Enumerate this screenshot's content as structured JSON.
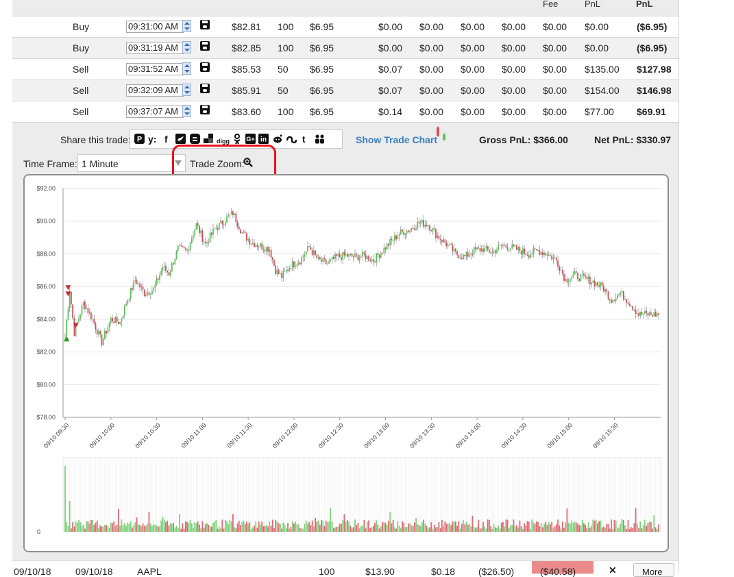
{
  "table_header": {
    "col_fee": "Fee",
    "col_pnl": "PnL",
    "col_net_pnl": "PnL"
  },
  "trades": [
    {
      "side": "Buy",
      "time": "09:31:00 AM",
      "price": "$82.81",
      "qty": "100",
      "commission": "$6.95",
      "f1": "$0.00",
      "f2": "$0.00",
      "f3": "$0.00",
      "f4": "$0.00",
      "f5": "$0.00",
      "pnl": "$0.00",
      "net": "($6.95)"
    },
    {
      "side": "Buy",
      "time": "09:31:19 AM",
      "price": "$82.85",
      "qty": "100",
      "commission": "$6.95",
      "f1": "$0.00",
      "f2": "$0.00",
      "f3": "$0.00",
      "f4": "$0.00",
      "f5": "$0.00",
      "pnl": "$0.00",
      "net": "($6.95)"
    },
    {
      "side": "Sell",
      "time": "09:31:52 AM",
      "price": "$85.53",
      "qty": "50",
      "commission": "$6.95",
      "f1": "$0.07",
      "f2": "$0.00",
      "f3": "$0.00",
      "f4": "$0.00",
      "f5": "$0.00",
      "pnl": "$135.00",
      "net": "$127.98"
    },
    {
      "side": "Sell",
      "time": "09:32:09 AM",
      "price": "$85.91",
      "qty": "50",
      "commission": "$6.95",
      "f1": "$0.07",
      "f2": "$0.00",
      "f3": "$0.00",
      "f4": "$0.00",
      "f5": "$0.00",
      "pnl": "$154.00",
      "net": "$146.98"
    },
    {
      "side": "Sell",
      "time": "09:37:07 AM",
      "price": "$83.60",
      "qty": "100",
      "commission": "$6.95",
      "f1": "$0.14",
      "f2": "$0.00",
      "f3": "$0.00",
      "f4": "$0.00",
      "f5": "$0.00",
      "pnl": "$77.00",
      "net": "$69.91"
    }
  ],
  "share": {
    "label": "Share this trade:",
    "icons": [
      "pinterest-icon",
      "yummly-icon",
      "facebook-icon",
      "twitter-icon",
      "blogger-icon",
      "delicious-icon",
      "digg-icon",
      "odnoklassniki-icon",
      "google-plus-icon",
      "linkedin-icon",
      "reddit-icon",
      "stumbleupon-icon",
      "tumblr-icon",
      "myspace-icon"
    ],
    "digg_text": "digg"
  },
  "show_trade_chart": "Show Trade Chart",
  "gross_pnl": "Gross PnL: $366.00",
  "net_pnl": "Net PnL: $330.97",
  "time_frame": {
    "label": "Time Frame:",
    "value": "1 Minute"
  },
  "trade_zoom": {
    "label": "Trade Zoom:"
  },
  "colors": {
    "up": "#5cc257",
    "down": "#d0505a",
    "highlight_oval": "#e8141e",
    "link": "#3a7fc0"
  },
  "chart_data": {
    "type": "candlestick",
    "y_ticks": [
      "$78.00",
      "$80.00",
      "$82.00",
      "$84.00",
      "$86.00",
      "$88.00",
      "$90.00",
      "$92.00"
    ],
    "ylim": [
      78,
      92
    ],
    "x_ticks": [
      "09/10 09:30",
      "09/10 10:00",
      "09/10 10:30",
      "09/10 11:00",
      "09/10 11:30",
      "09/10 12:00",
      "09/10 12:30",
      "09/10 13:00",
      "09/10 13:30",
      "09/10 14:00",
      "09/10 14:30",
      "09/10 15:00",
      "09/10 15:30"
    ],
    "close_anchors": [
      [
        0,
        83.0
      ],
      [
        3,
        85.8
      ],
      [
        6,
        83.2
      ],
      [
        12,
        85.0
      ],
      [
        18,
        84.0
      ],
      [
        24,
        82.6
      ],
      [
        30,
        84.0
      ],
      [
        36,
        83.8
      ],
      [
        40,
        85.0
      ],
      [
        46,
        86.4
      ],
      [
        52,
        85.6
      ],
      [
        58,
        85.8
      ],
      [
        64,
        87.2
      ],
      [
        68,
        86.8
      ],
      [
        74,
        88.3
      ],
      [
        80,
        88.2
      ],
      [
        86,
        89.8
      ],
      [
        92,
        88.6
      ],
      [
        98,
        89.5
      ],
      [
        104,
        90.0
      ],
      [
        110,
        90.5
      ],
      [
        116,
        89.3
      ],
      [
        122,
        88.7
      ],
      [
        128,
        88.5
      ],
      [
        134,
        88.3
      ],
      [
        138,
        87.0
      ],
      [
        142,
        86.6
      ],
      [
        148,
        87.3
      ],
      [
        154,
        87.6
      ],
      [
        160,
        88.4
      ],
      [
        166,
        87.6
      ],
      [
        172,
        87.4
      ],
      [
        178,
        87.8
      ],
      [
        184,
        87.9
      ],
      [
        190,
        87.8
      ],
      [
        196,
        87.9
      ],
      [
        202,
        87.6
      ],
      [
        208,
        88.2
      ],
      [
        214,
        88.8
      ],
      [
        220,
        89.3
      ],
      [
        226,
        89.5
      ],
      [
        232,
        89.9
      ],
      [
        238,
        89.8
      ],
      [
        244,
        89.1
      ],
      [
        250,
        88.6
      ],
      [
        256,
        88.0
      ],
      [
        262,
        87.8
      ],
      [
        268,
        88.2
      ],
      [
        274,
        88.3
      ],
      [
        280,
        88.1
      ],
      [
        286,
        88.5
      ],
      [
        292,
        88.4
      ],
      [
        298,
        88.2
      ],
      [
        304,
        88.0
      ],
      [
        310,
        88.2
      ],
      [
        316,
        88.0
      ],
      [
        322,
        87.6
      ],
      [
        328,
        86.4
      ],
      [
        334,
        86.7
      ],
      [
        340,
        86.5
      ],
      [
        346,
        86.3
      ],
      [
        352,
        86.0
      ],
      [
        358,
        85.2
      ],
      [
        364,
        85.6
      ],
      [
        370,
        85.0
      ],
      [
        376,
        84.3
      ]
    ],
    "trade_markers": [
      {
        "side": "Buy",
        "minute": 1,
        "price": 82.81
      },
      {
        "side": "Buy",
        "minute": 1,
        "price": 82.85
      },
      {
        "side": "Sell",
        "minute": 2,
        "price": 85.53
      },
      {
        "side": "Sell",
        "minute": 2,
        "price": 85.91
      },
      {
        "side": "Sell",
        "minute": 7,
        "price": 83.6
      }
    ],
    "volume_label": "0",
    "minutes": 390
  },
  "bottom_row": {
    "open_date": "09/10/18",
    "close_date": "09/10/18",
    "symbol": "AAPL",
    "qty": "100",
    "price": "$13.90",
    "fee": "$0.18",
    "gross": "($26.50)",
    "net": "($40.58)",
    "delete_glyph": "✕",
    "more_label": "More"
  }
}
